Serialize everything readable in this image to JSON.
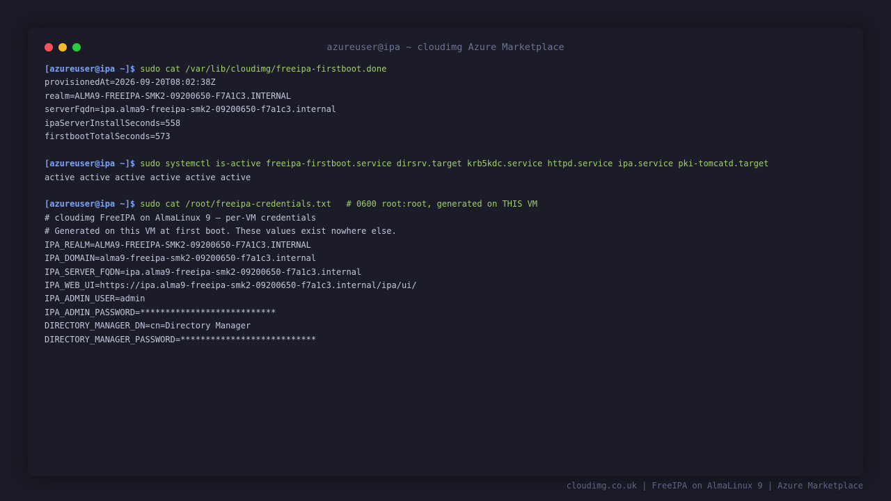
{
  "window": {
    "title": "azureuser@ipa ~ cloudimg Azure Marketplace",
    "buttons": {
      "close_color": "#f7535e",
      "minimize_color": "#f5b82e",
      "maximize_color": "#2bc840"
    }
  },
  "colors": {
    "background": "#1a1b26",
    "prompt": "#7aa2f7",
    "command": "#9ece6a",
    "output": "#c0c6dc"
  },
  "terminal": {
    "blocks": [
      {
        "prompt": "[azureuser@ipa ~]$",
        "command": "sudo cat /var/lib/cloudimg/freeipa-firstboot.done",
        "output": [
          "provisionedAt=2026-09-20T08:02:38Z",
          "realm=ALMA9-FREEIPA-SMK2-09200650-F7A1C3.INTERNAL",
          "serverFqdn=ipa.alma9-freeipa-smk2-09200650-f7a1c3.internal",
          "ipaServerInstallSeconds=558",
          "firstbootTotalSeconds=573"
        ]
      },
      {
        "prompt": "[azureuser@ipa ~]$",
        "command": "sudo systemctl is-active freeipa-firstboot.service dirsrv.target krb5kdc.service httpd.service ipa.service pki-tomcatd.target",
        "output": [
          "active active active active active active"
        ]
      },
      {
        "prompt": "[azureuser@ipa ~]$",
        "command": "sudo cat /root/freeipa-credentials.txt   # 0600 root:root, generated on THIS VM",
        "output": [
          "# cloudimg FreeIPA on AlmaLinux 9 — per-VM credentials",
          "# Generated on this VM at first boot. These values exist nowhere else.",
          "IPA_REALM=ALMA9-FREEIPA-SMK2-09200650-F7A1C3.INTERNAL",
          "IPA_DOMAIN=alma9-freeipa-smk2-09200650-f7a1c3.internal",
          "IPA_SERVER_FQDN=ipa.alma9-freeipa-smk2-09200650-f7a1c3.internal",
          "IPA_WEB_UI=https://ipa.alma9-freeipa-smk2-09200650-f7a1c3.internal/ipa/ui/",
          "IPA_ADMIN_USER=admin",
          "IPA_ADMIN_PASSWORD=***************************",
          "DIRECTORY_MANAGER_DN=cn=Directory Manager",
          "DIRECTORY_MANAGER_PASSWORD=***************************"
        ]
      }
    ]
  },
  "footer": {
    "text": "cloudimg.co.uk | FreeIPA on AlmaLinux 9 | Azure Marketplace"
  }
}
